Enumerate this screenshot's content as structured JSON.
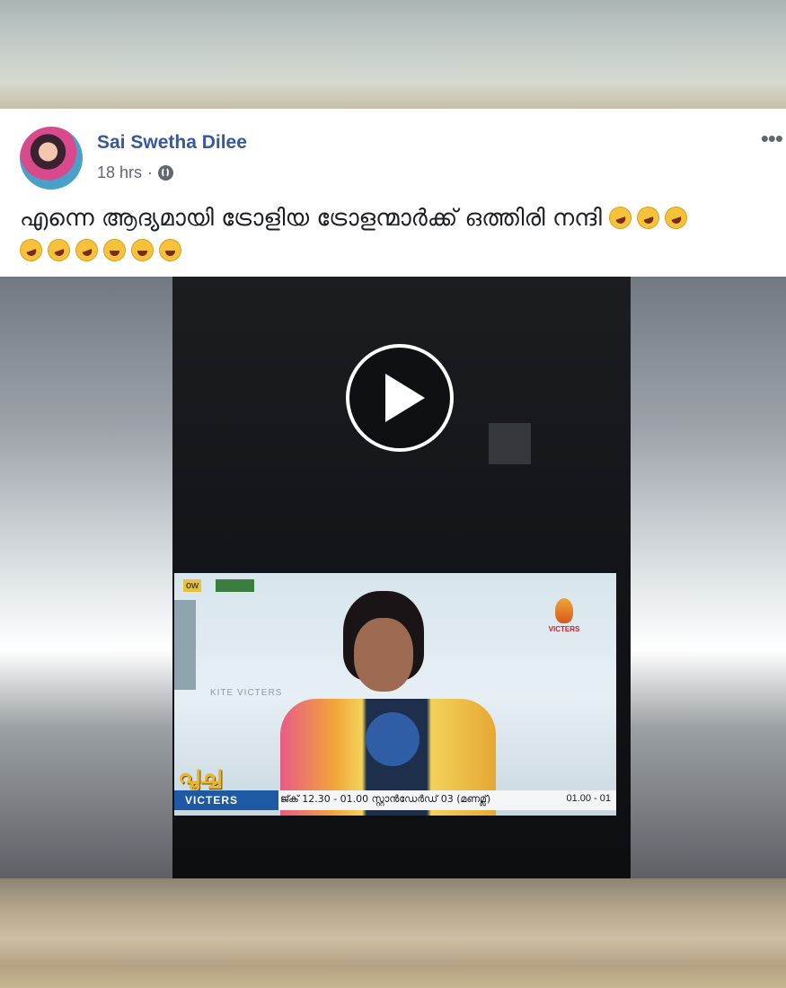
{
  "post": {
    "author": "Sai Swetha Dilee",
    "time": "18 hrs",
    "privacy_icon": "globe-icon",
    "more_label": "•••",
    "text": "എന്നെ ആദ്യമായി ട്രോളിയ ട്രോളന്മാർക്ക് ഒത്തിരി നന്ദി",
    "emoji_row1": [
      "rofl",
      "rofl",
      "rofl"
    ],
    "emoji_row2": [
      "rofl",
      "rofl",
      "rofl",
      "laugh",
      "laugh",
      "laugh"
    ]
  },
  "video": {
    "play_icon": "play-icon",
    "tv": {
      "tag_now": "ow",
      "channel_logo_text": "VICTERS",
      "watermark": "KITE VICTERS",
      "show_title": "പൂച്ച",
      "ticker_brand": "VICTERS",
      "ticker_text": "ജ്ക് 12.30 - 01.00 സ്റ്റാൻഡേർഡ് 03 (മണമ്ല്)",
      "ticker_time": "01.00 - 01"
    }
  },
  "colors": {
    "author_link": "#385898",
    "meta_text": "#616770",
    "ticker_brand_bg": "#1d5aa3"
  }
}
